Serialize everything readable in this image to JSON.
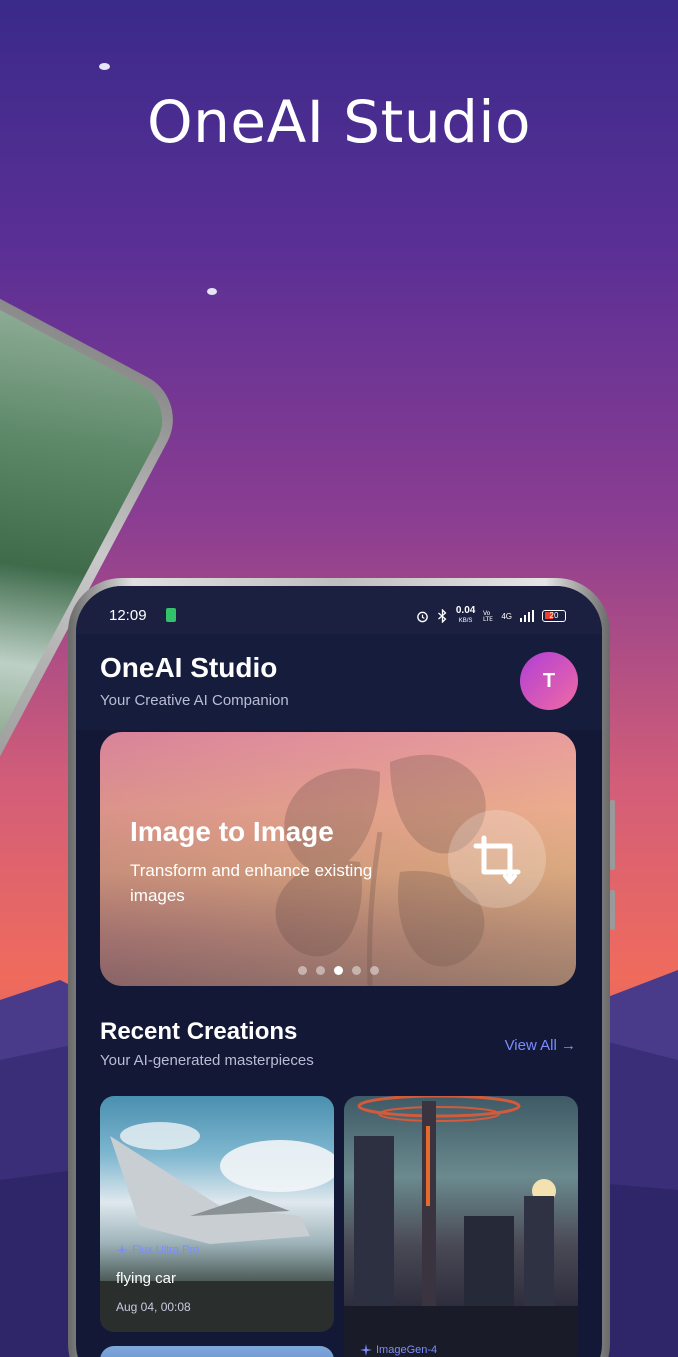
{
  "hero": {
    "title": "OneAI Studio"
  },
  "status_bar": {
    "time": "12:09",
    "speed": "0.04",
    "speed_unit": "KB/S",
    "network": "4G",
    "battery": "20"
  },
  "header": {
    "title": "OneAI Studio",
    "subtitle": "Your Creative AI Companion",
    "avatar_initial": "T"
  },
  "banner": {
    "title": "Image to Image",
    "description": "Transform and enhance existing images",
    "icon": "crop-icon",
    "slides_total": 5,
    "active_slide": 3
  },
  "recent": {
    "title": "Recent Creations",
    "subtitle": "Your AI-generated masterpieces",
    "view_all": "View All",
    "items": [
      {
        "model": "Flux Ultra Pro",
        "prompt": "flying car",
        "date": "Aug 04, 00:08"
      },
      {
        "model": "ImageGen-4",
        "prompt": "",
        "date": ""
      }
    ]
  },
  "colors": {
    "accent": "#7b8cff",
    "screen_bg": "#131836",
    "avatar_from": "#b03fd6",
    "avatar_to": "#f06aa3"
  }
}
